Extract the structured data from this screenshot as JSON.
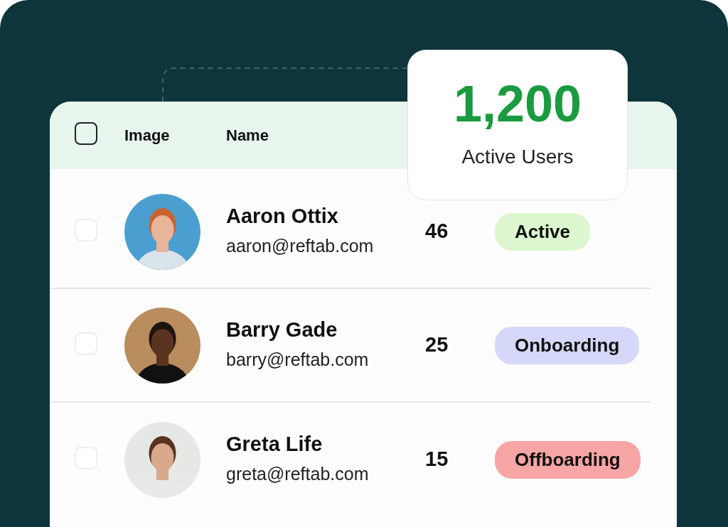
{
  "stat_card": {
    "value": "1,200",
    "label": "Active Users"
  },
  "table": {
    "select_all": {
      "checked": false
    },
    "columns": [
      {
        "label": "Image"
      },
      {
        "label": "Name"
      }
    ],
    "rows": [
      {
        "checked": false,
        "name": "Aaron Ottix",
        "email": "aaron@reftab.com",
        "count": "46",
        "status": {
          "label": "Active",
          "color": "#dcf7cf"
        }
      },
      {
        "checked": false,
        "name": "Barry Gade",
        "email": "barry@reftab.com",
        "count": "25",
        "status": {
          "label": "Onboarding",
          "color": "#d5d8f8"
        }
      },
      {
        "checked": false,
        "name": "Greta Life",
        "email": "greta@reftab.com",
        "count": "15",
        "status": {
          "label": "Offboarding",
          "color": "#f7a5a5"
        }
      }
    ]
  }
}
